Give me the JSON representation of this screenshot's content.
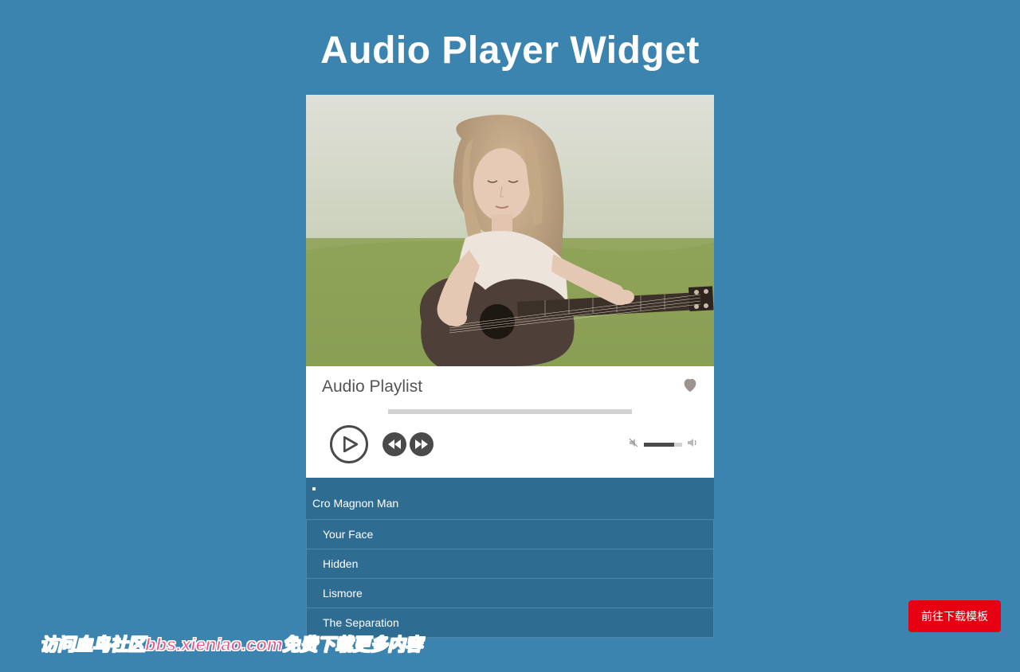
{
  "page": {
    "title": "Audio Player Widget"
  },
  "player": {
    "playlist_title": "Audio Playlist",
    "volume_percent": 80
  },
  "playlist": {
    "items": [
      {
        "title": "Cro Magnon Man",
        "active": true
      },
      {
        "title": "Your Face",
        "active": false
      },
      {
        "title": "Hidden",
        "active": false
      },
      {
        "title": "Lismore",
        "active": false
      },
      {
        "title": "The Separation",
        "active": false
      }
    ]
  },
  "download_button": {
    "label": "前往下载模板"
  },
  "watermark": {
    "text": "访问血鸟社区bbs.xieniao.com免费下载更多内容"
  }
}
